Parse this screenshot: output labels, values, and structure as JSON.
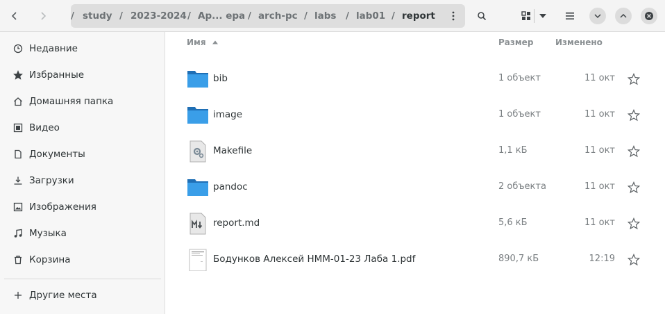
{
  "header": {
    "path": [
      {
        "label": "/"
      },
      {
        "label": "study"
      },
      {
        "label": "2023-2024"
      },
      {
        "label": "Ар... ера"
      },
      {
        "label": "arch-pc"
      },
      {
        "label": "labs"
      },
      {
        "label": "lab01"
      },
      {
        "label": "report"
      }
    ]
  },
  "sidebar": {
    "items": [
      {
        "label": "Недавние",
        "icon": "clock-icon"
      },
      {
        "label": "Избранные",
        "icon": "star-icon"
      },
      {
        "label": "Домашняя папка",
        "icon": "home-icon"
      },
      {
        "label": "Видео",
        "icon": "video-icon"
      },
      {
        "label": "Документы",
        "icon": "document-icon"
      },
      {
        "label": "Загрузки",
        "icon": "download-icon"
      },
      {
        "label": "Изображения",
        "icon": "image-icon"
      },
      {
        "label": "Музыка",
        "icon": "music-icon"
      },
      {
        "label": "Корзина",
        "icon": "trash-icon"
      }
    ],
    "other_places": "Другие места"
  },
  "columns": {
    "name": "Имя",
    "size": "Размер",
    "modified": "Изменено"
  },
  "files": [
    {
      "name": "bib",
      "size": "1 объект",
      "modified": "11 окт",
      "type": "folder"
    },
    {
      "name": "image",
      "size": "1 объект",
      "modified": "11 окт",
      "type": "folder"
    },
    {
      "name": "Makefile",
      "size": "1,1 кБ",
      "modified": "11 окт",
      "type": "makefile"
    },
    {
      "name": "pandoc",
      "size": "2 объекта",
      "modified": "11 окт",
      "type": "folder"
    },
    {
      "name": "report.md",
      "size": "5,6 кБ",
      "modified": "11 окт",
      "type": "markdown"
    },
    {
      "name": "Бодунков Алексей НММ-01-23 Лаба 1.pdf",
      "size": "890,7 кБ",
      "modified": "12:19",
      "type": "pdf"
    }
  ],
  "colors": {
    "folder": "#3a9ee8",
    "folder_dark": "#1f6fb5",
    "pathbar_bg": "#dedede",
    "accent": "#3584e4"
  }
}
